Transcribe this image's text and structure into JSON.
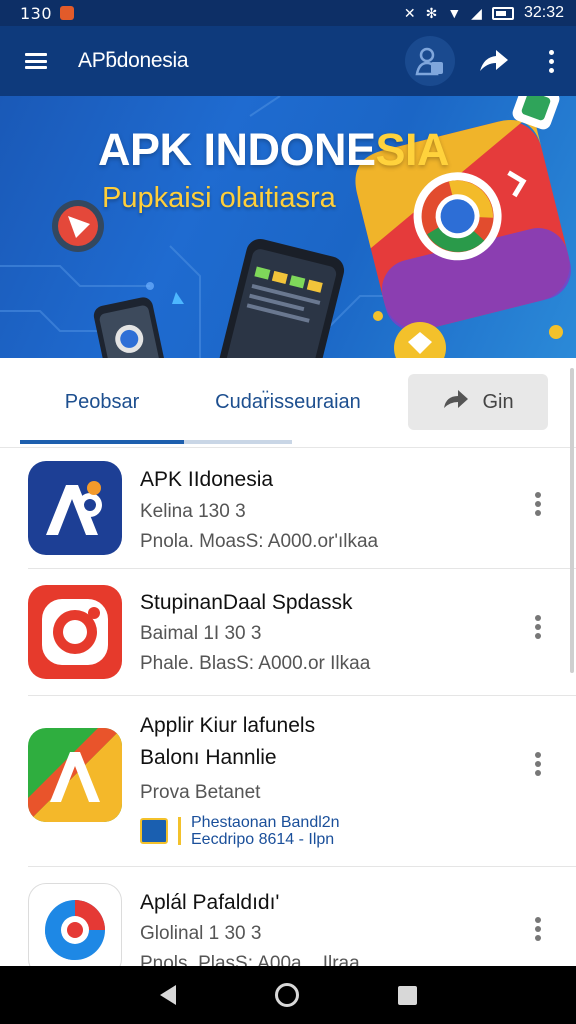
{
  "status_bar": {
    "time_left": "130",
    "time_right": "32:32"
  },
  "app_bar": {
    "title": "APƃdonesia"
  },
  "hero": {
    "title_main": "APK INDONE",
    "title_highlight": "SIA",
    "subtitle": "Pupkaisi olaitiasra"
  },
  "tabs": [
    {
      "label": "Peobsar",
      "selected": true
    },
    {
      "label": "Cudar̈isseuraian",
      "selected": false
    }
  ],
  "action_button": {
    "label": "Gin"
  },
  "apps": [
    {
      "name": "APK IIdonesia",
      "line1": "Kelina 130 3",
      "line2": "Pnola. MoasS:  A000.or'ılkaa",
      "icon": "apk-logo-icon"
    },
    {
      "name": "StupinanDaal Spdassk",
      "line1": "Baimal 1I 30 3",
      "line2": "Phale. BlasS:  A000.or Ilkaa",
      "icon": "camera-app-icon"
    },
    {
      "name": "Applir Kiur lafunels",
      "name2": "Balonı Hannlie",
      "line1": "Prova Betanet",
      "badge_line1": "Phestaonan Bandl2n",
      "badge_line2": "Eecdripo 8614   - Ilpn",
      "icon": "letter-a-app-icon"
    },
    {
      "name": "Aplál Pafaldıdı'",
      "line1": "Glolinal 1 30 3",
      "line2": "Pnols. PlasS:  A00a... Ilraa",
      "icon": "location-pin-app-icon"
    }
  ],
  "colors": {
    "app_bar": "#0e3a7c",
    "accent": "#1e5fae",
    "hero_highlight": "#ffd23c"
  }
}
